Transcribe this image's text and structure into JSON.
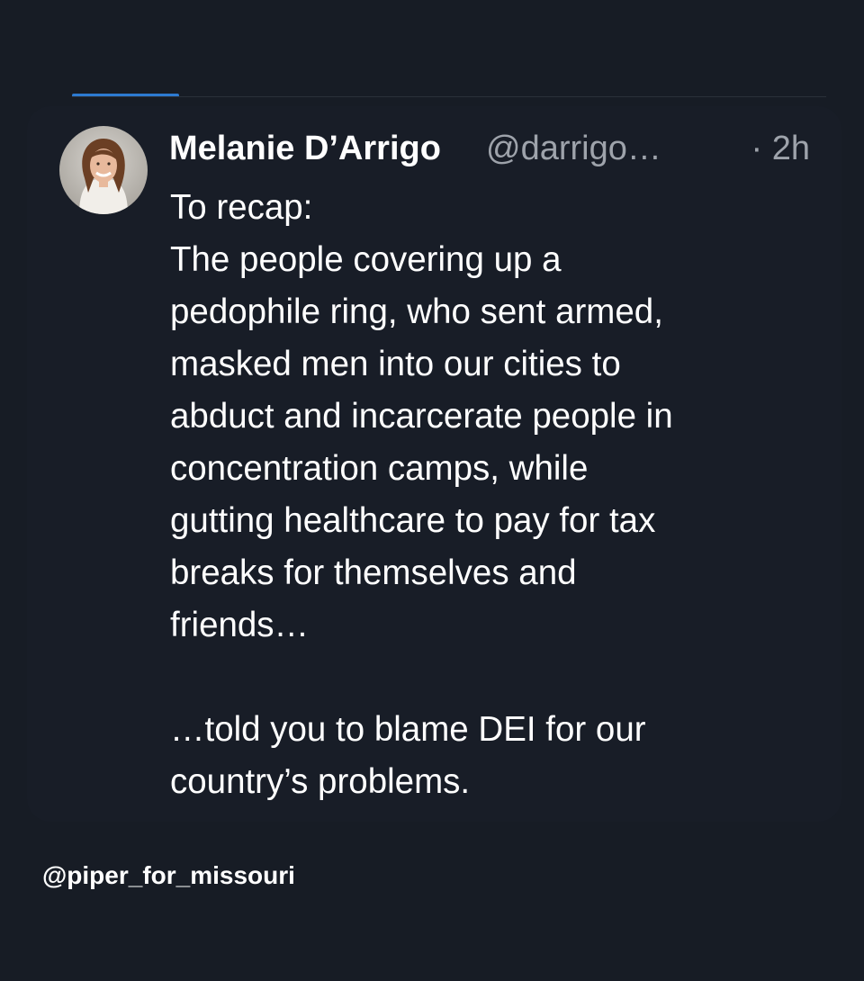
{
  "post": {
    "author_name": "Melanie D’Arrigo",
    "author_handle": "@darrigo…",
    "time": "· 2h",
    "avatar_icon": "user-avatar-photo",
    "body_lines": "To recap:\nThe people covering up a\npedophile ring, who sent armed,\nmasked men into our cities to\nabduct and incarcerate people in\nconcentration camps, while\ngutting healthcare to pay for tax\nbreaks for themselves and\nfriends…",
    "body_ending": "…told you to blame DEI for our\ncountry’s problems."
  },
  "watermark": "@piper_for_missouri",
  "colors": {
    "background": "#171c25",
    "accent": "#2d7ad1",
    "text": "#ffffff",
    "muted": "#9ea3ab"
  }
}
